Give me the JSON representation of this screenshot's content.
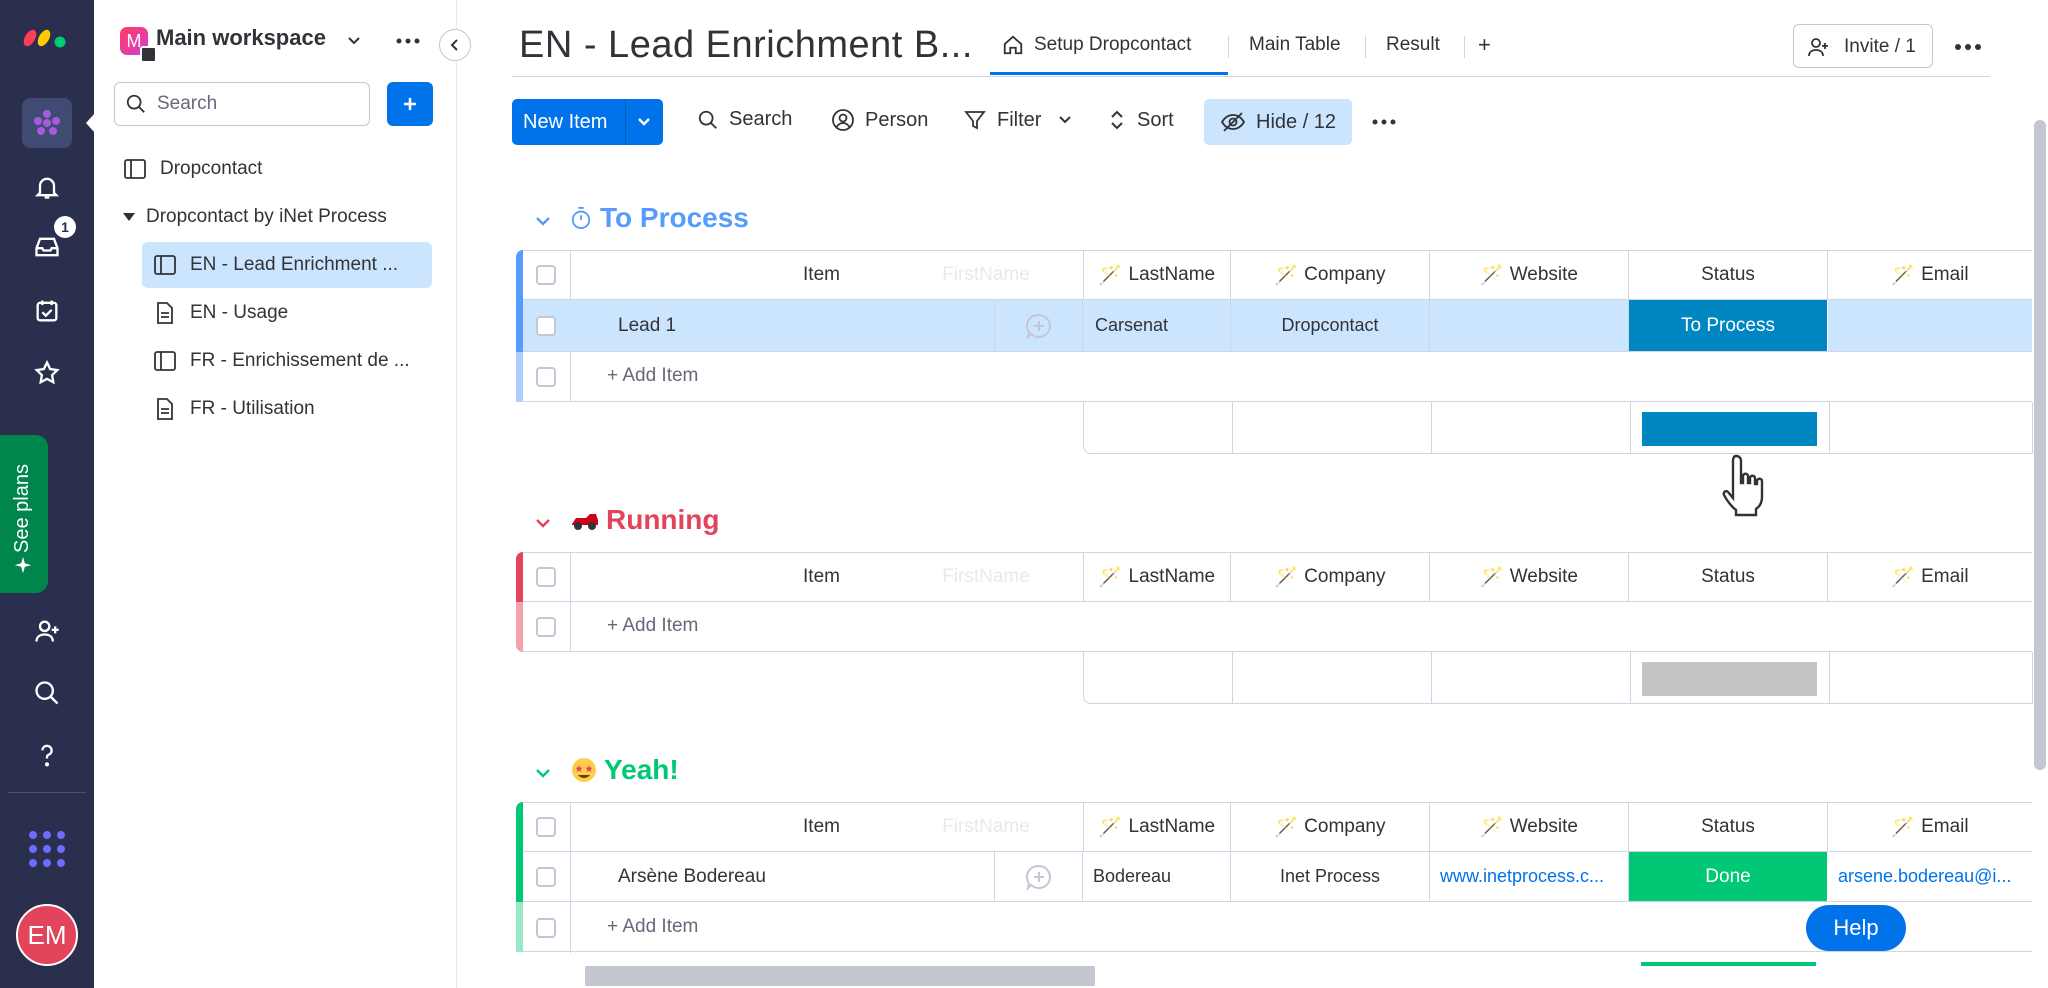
{
  "rail": {
    "notifications_badge": "1",
    "see_plans": "See plans",
    "avatar_initials": "EM"
  },
  "sidebar": {
    "workspace_initial": "M",
    "workspace_name": "Main workspace",
    "search_placeholder": "Search",
    "items": [
      {
        "label": "Dropcontact",
        "icon": "board-icon"
      },
      {
        "label": "Dropcontact by iNet Process",
        "icon": "folder-triangle-icon"
      },
      {
        "label": "EN - Lead Enrichment ...",
        "icon": "board-icon"
      },
      {
        "label": "EN - Usage",
        "icon": "doc-icon"
      },
      {
        "label": "FR - Enrichissement de ...",
        "icon": "board-icon"
      },
      {
        "label": "FR - Utilisation",
        "icon": "doc-icon"
      }
    ]
  },
  "header": {
    "board_title": "EN - Lead Enrichment B...",
    "tabs": [
      {
        "label": "Setup Dropcontact"
      },
      {
        "label": "Main Table"
      },
      {
        "label": "Result"
      }
    ],
    "add_tab": "+",
    "invite_label": "Invite / 1"
  },
  "toolbar": {
    "new_item": "New Item",
    "search": "Search",
    "person": "Person",
    "filter": "Filter",
    "sort": "Sort",
    "hide": "Hide / 12"
  },
  "columns": {
    "item": "Item",
    "firstname": "FirstName",
    "lastname": "LastName",
    "company": "Company",
    "website": "Website",
    "status": "Status",
    "email": "Email"
  },
  "add_item_label": "+ Add Item",
  "groups": [
    {
      "title": "To Process",
      "color": "#579bfc",
      "rows": [
        {
          "item": "Lead 1",
          "lastname": "Carsenat",
          "company": "Dropcontact",
          "website": "",
          "status": "To Process",
          "status_color": "#0086c0",
          "email": ""
        }
      ],
      "summary_color": "#0086c0"
    },
    {
      "title": "Running",
      "color": "#e2445c",
      "rows": [],
      "summary_color": "#c4c4c4"
    },
    {
      "title": "Yeah!",
      "color": "#00c875",
      "rows": [
        {
          "item": "Arsène Bodereau",
          "lastname": "Bodereau",
          "company": "Inet Process",
          "website": "www.inetprocess.c...",
          "status": "Done",
          "status_color": "#00c875",
          "email": "arsene.bodereau@i..."
        }
      ],
      "summary_color": "#00c875"
    }
  ],
  "help_label": "Help"
}
